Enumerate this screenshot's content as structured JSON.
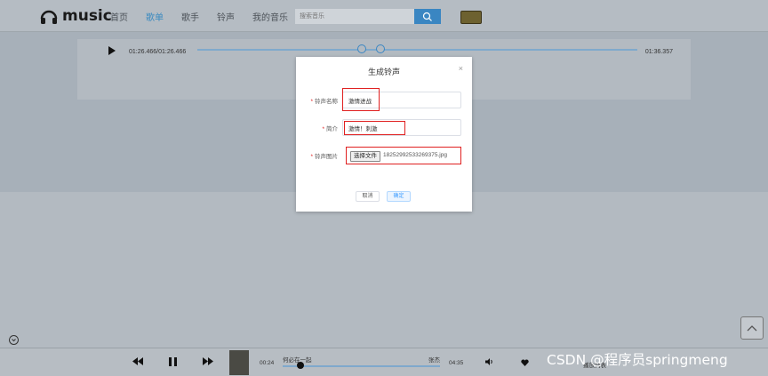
{
  "header": {
    "logo_text": "music",
    "nav": [
      "首页",
      "歌单",
      "歌手",
      "铃声",
      "我的音乐"
    ],
    "search_placeholder": "搜索音乐"
  },
  "player_card": {
    "time_left": "01:26.466/01:26.466",
    "time_right": "01:36.357"
  },
  "modal": {
    "title": "生成铃声",
    "close": "×",
    "fields": [
      {
        "label": "铃声名称",
        "value": "激情进战"
      },
      {
        "label": "简介",
        "value": "激情！刺激"
      },
      {
        "label": "铃声图片",
        "button": "选择文件",
        "file": "1825299253326​9375.jpg"
      }
    ],
    "cancel": "取消",
    "confirm": "确定"
  },
  "bottom_player": {
    "current_time": "00:24",
    "song": "何必在一起",
    "artist": "张杰",
    "total_time": "04:35",
    "playlist_label": "播放列表"
  },
  "watermark": "CSDN @程序员springmeng",
  "colors": {
    "accent": "#3a86c2",
    "highlight": "#e02020",
    "primary": "#409eff"
  }
}
